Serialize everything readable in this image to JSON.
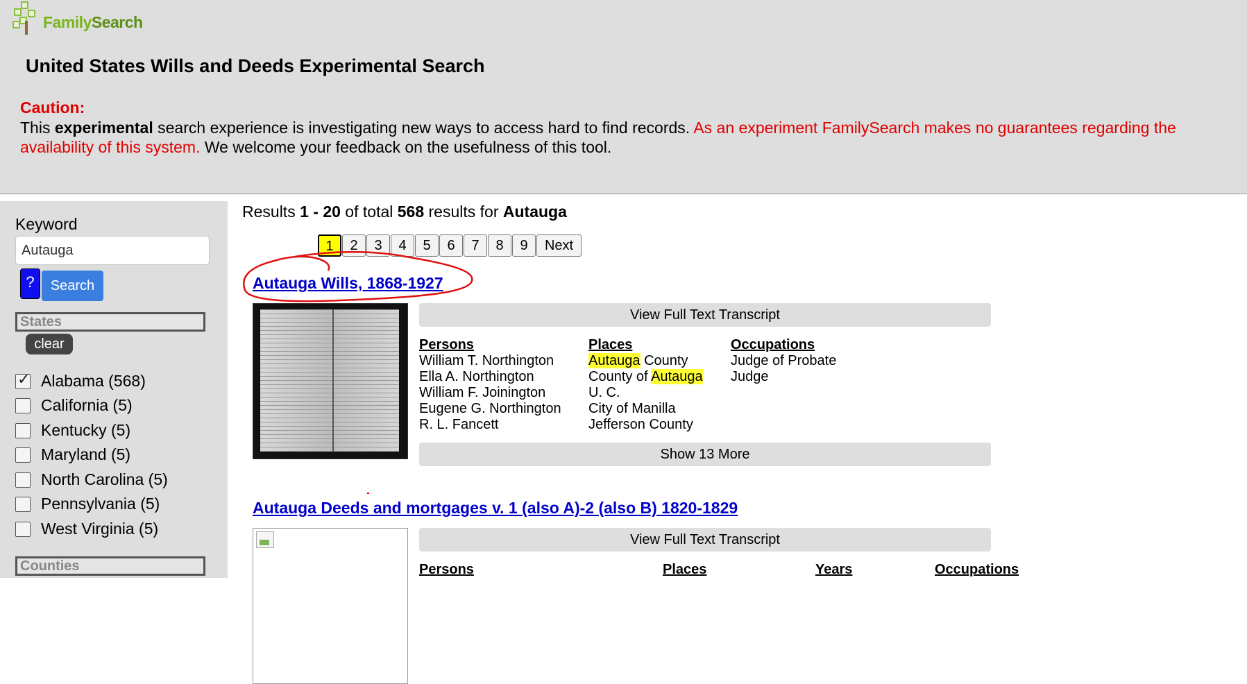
{
  "brand": {
    "name_part1": "Family",
    "name_part2": "Search"
  },
  "header": {
    "title": "United States Wills and Deeds Experimental Search",
    "caution_label": "Caution:",
    "caution_prefix": "This ",
    "caution_bold": "experimental",
    "caution_mid": " search experience is investigating new ways to access hard to find records. ",
    "caution_red": "As an experiment FamilySearch makes no guarantees regarding the availability of this system.",
    "caution_suffix": " We welcome your feedback on the usefulness of this tool."
  },
  "sidebar": {
    "keyword_label": "Keyword",
    "keyword_value": "Autauga",
    "help_label": "?",
    "search_label": "Search",
    "states_label": "States",
    "clear_label": "clear",
    "states": [
      {
        "label": "Alabama (568)",
        "checked": true
      },
      {
        "label": "California (5)",
        "checked": false
      },
      {
        "label": "Kentucky (5)",
        "checked": false
      },
      {
        "label": "Maryland (5)",
        "checked": false
      },
      {
        "label": "North Carolina (5)",
        "checked": false
      },
      {
        "label": "Pennsylvania (5)",
        "checked": false
      },
      {
        "label": "West Virginia (5)",
        "checked": false
      }
    ],
    "counties_label": "Counties"
  },
  "results": {
    "summary_prefix": "Results ",
    "summary_range": "1 - 20",
    "summary_mid": " of total ",
    "summary_total": "568",
    "summary_for": " results for ",
    "summary_query": "Autauga",
    "pages": [
      "1",
      "2",
      "3",
      "4",
      "5",
      "6",
      "7",
      "8",
      "9"
    ],
    "current_page": "1",
    "next_label": "Next",
    "items": [
      {
        "title": "Autauga Wills, 1868-1927",
        "transcript_label": "View Full Text Transcript",
        "persons_header": "Persons",
        "persons": [
          "William T. Northington",
          "Ella A. Northington",
          "William F. Joinington",
          "Eugene G. Northington",
          "R. L. Fancett"
        ],
        "places_header": "Places",
        "places": [
          {
            "pre": "",
            "hl": "Autauga",
            "post": " County"
          },
          {
            "pre": "County of ",
            "hl": "Autauga",
            "post": ""
          },
          {
            "pre": "U. C.",
            "hl": "",
            "post": ""
          },
          {
            "pre": "City of Manilla",
            "hl": "",
            "post": ""
          },
          {
            "pre": "Jefferson County",
            "hl": "",
            "post": ""
          }
        ],
        "occupations_header": "Occupations",
        "occupations": [
          "Judge of Probate",
          "Judge"
        ],
        "more_label": "Show 13 More"
      },
      {
        "title": "Autauga Deeds and mortgages v. 1 (also A)-2 (also B) 1820-1829",
        "transcript_label": "View Full Text Transcript",
        "persons_header": "Persons",
        "places_header": "Places",
        "years_header": "Years",
        "occupations_header": "Occupations"
      }
    ]
  },
  "colors": {
    "accent_red": "#e00000",
    "link_blue": "#0000cc",
    "highlight": "#ffff00",
    "search_blue": "#3a7ee0"
  }
}
